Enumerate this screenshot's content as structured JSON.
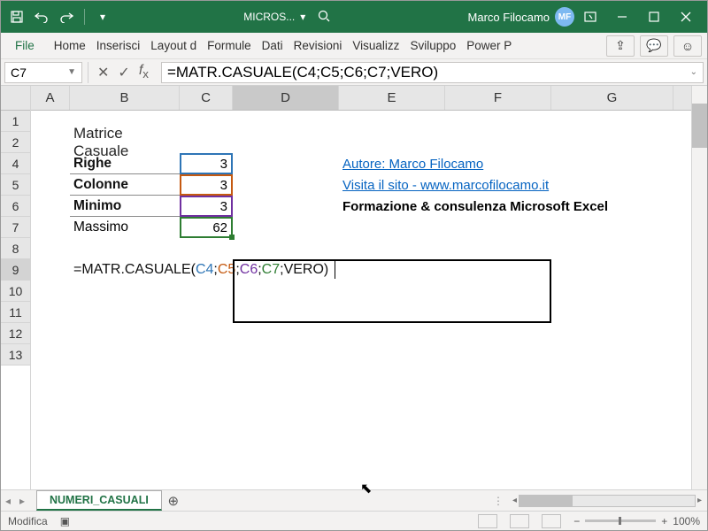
{
  "titlebar": {
    "doc_name": "MICROS...",
    "user_name": "Marco Filocamo",
    "user_initials": "MF"
  },
  "ribbon": {
    "file": "File",
    "tabs": [
      "Home",
      "Inserisci",
      "Layout d",
      "Formule",
      "Dati",
      "Revisioni",
      "Visualizz",
      "Sviluppo",
      "Power P"
    ]
  },
  "formula_bar": {
    "name_box": "C7",
    "formula": "=MATR.CASUALE(C4;C5;C6;C7;VERO)"
  },
  "columns": [
    "A",
    "B",
    "C",
    "D",
    "E",
    "F",
    "G"
  ],
  "rows": [
    "1",
    "2",
    "4",
    "5",
    "6",
    "7",
    "8",
    "9",
    "10",
    "11",
    "12",
    "13"
  ],
  "sheet": {
    "title": "Matrice Casuale",
    "labels": {
      "righe": "Righe",
      "colonne": "Colonne",
      "minimo": "Minimo",
      "massimo": "Massimo"
    },
    "values": {
      "righe": "3",
      "colonne": "3",
      "minimo": "3",
      "massimo": "62"
    },
    "link_author": "Autore: Marco Filocamo",
    "link_site": "Visita il sito - www.marcofilocamo.it",
    "info": "Formazione & consulenza Microsoft Excel",
    "formula_parts": {
      "p0": "=MATR.CASUALE(",
      "c4": "C4",
      "s": ";",
      "c5": "C5",
      "c6": "C6",
      "c7": "C7",
      "p1": ";VERO)"
    }
  },
  "tabs": {
    "sheet_name": "NUMERI_CASUALI"
  },
  "status": {
    "mode": "Modifica",
    "zoom": "100%"
  }
}
